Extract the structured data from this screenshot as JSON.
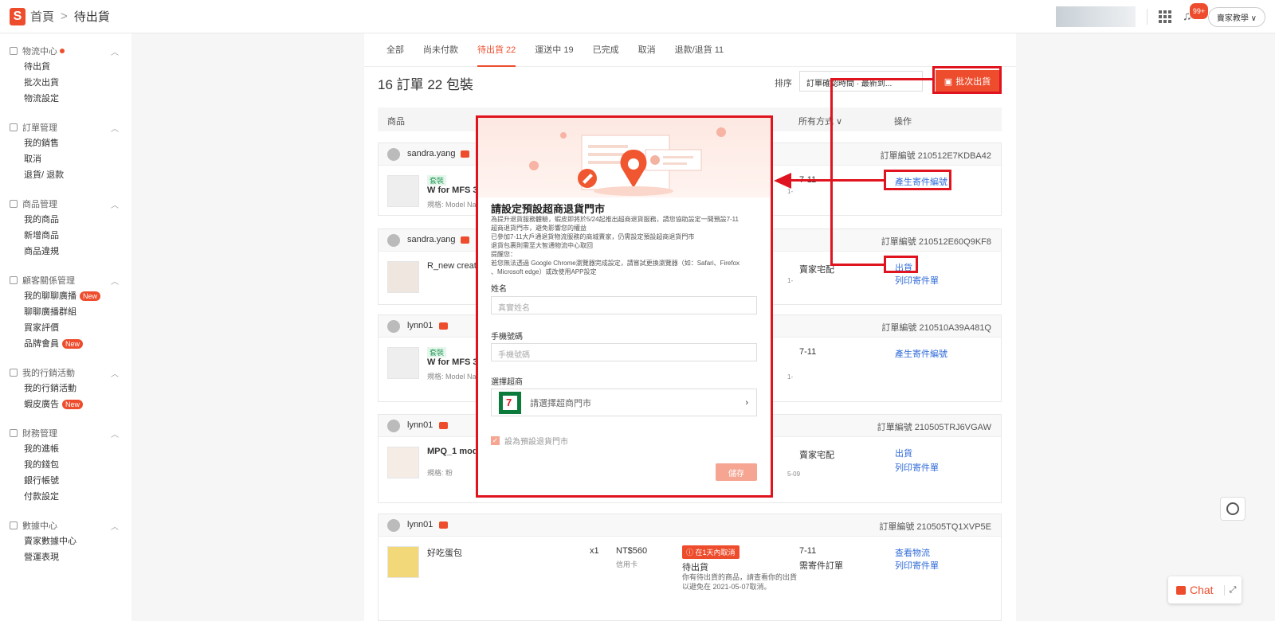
{
  "header": {
    "logo_letter": "S",
    "breadcrumb_home": "首頁",
    "breadcrumb_sep": ">",
    "breadcrumb_current": "待出貨",
    "notif_badge": "99+",
    "seller_button": "賣家教學 ∨"
  },
  "sidebar": {
    "groups": [
      {
        "title": "物流中心",
        "items": [
          "待出貨",
          "批次出貨",
          "物流設定"
        ]
      },
      {
        "title": "訂單管理",
        "items": [
          "我的銷售",
          "取消",
          "退貨/ 退款"
        ]
      },
      {
        "title": "商品管理",
        "items": [
          "我的商品",
          "新增商品",
          "商品違規"
        ]
      },
      {
        "title": "顧客關係管理",
        "items": [
          "我的聊聊廣播",
          "聊聊廣播群組",
          "買家評價",
          "品牌會員"
        ]
      },
      {
        "title": "我的行銷活動",
        "items": [
          "我的行銷活動",
          "蝦皮廣告"
        ]
      },
      {
        "title": "財務管理",
        "items": [
          "我的進帳",
          "我的錢包",
          "銀行帳號",
          "付款設定"
        ]
      },
      {
        "title": "數據中心",
        "items": [
          "賣家數據中心",
          "營運表現"
        ]
      }
    ],
    "new_badge": "New"
  },
  "tabs": [
    "全部",
    "尚未付款",
    "待出貨 22",
    "運送中 19",
    "已完成",
    "取消",
    "退款/退貨 11"
  ],
  "main": {
    "count_title": "16 訂單 22 包裝",
    "sort_label": "排序",
    "sort_value": "訂單確認時間 · 最新到...",
    "batch_button": "批次出貨",
    "table_headers": {
      "product": "商品",
      "shipping": "所有方式 ∨",
      "action": "操作"
    }
  },
  "orders": [
    {
      "user": "sandra.yang",
      "order_no": "訂單編號 210512E7KDBA42",
      "tag": "套裝",
      "product": "W for MFS 3(",
      "spec": "規格: Model Na",
      "shipping": "7-11",
      "fragment": "1-",
      "actions": [
        "產生寄件編號"
      ]
    },
    {
      "user": "sandra.yang",
      "order_no": "訂單編號 210512E60Q9KF8",
      "tag": "",
      "product": "R_new creat",
      "spec": "",
      "shipping": "賣家宅配",
      "fragment": "1-",
      "actions": [
        "出貨",
        "列印寄件單"
      ]
    },
    {
      "user": "lynn01",
      "order_no": "訂單編號 210510A39A481Q",
      "tag": "套裝",
      "product": "W for MFS 3(",
      "spec": "規格: Model Na",
      "shipping": "7-11",
      "fragment": "1-",
      "actions": [
        "產生寄件編號"
      ]
    },
    {
      "user": "lynn01",
      "order_no": "訂單編號 210505TRJ6VGAW",
      "tag": "",
      "product": "MPQ_1 mode",
      "spec": "規格: 粉",
      "shipping": "賣家宅配",
      "fragment": "5-09",
      "actions": [
        "出貨",
        "列印寄件單"
      ]
    },
    {
      "user": "lynn01",
      "order_no": "訂單編號 210505TQ1XVP5E",
      "tag": "",
      "product": "好吃蛋包",
      "spec": "",
      "qty": "x1",
      "price": "NT$560",
      "pay": "信用卡",
      "cancel_badge": "ⓘ 在1天內取消",
      "status": "待出貨",
      "status_desc": "你有待出貨的商品，請查看你的出貨以避免在 2021-05-07取消。",
      "shipping": "7-11",
      "shipping_sub": "需寄件訂單",
      "actions": [
        "查看物流",
        "列印寄件單"
      ]
    }
  ],
  "modal": {
    "title": "請設定預設超商退貨門市",
    "desc_lines": [
      "為提升退貨服務體驗，蝦皮即將於5/24起推出超商退貨服務，請您協助設定一間預設7-11",
      "超商退貨門市，避免影響您的權益",
      "已參加7-11大戶通退貨物流服務的商城賣家，仍需設定預設超商退貨門市",
      "退貨包裹則需至大智通物流中心取回",
      "提醒您：",
      "若您無法透過 Google Chrome瀏覽器完成設定，請嘗試更換瀏覽器（如：Safari、Firefox",
      "、Microsoft edge）或改使用APP設定"
    ],
    "name_label": "姓名",
    "name_placeholder": "真實姓名",
    "phone_label": "手機號碼",
    "phone_placeholder": "手機號碼",
    "store_label": "選擇超商",
    "store_logo": "7",
    "store_placeholder": "請選擇超商門市",
    "store_chevron": "›",
    "default_checkbox": "設為預設退貨門市",
    "save_button": "儲存"
  },
  "widgets": {
    "chat_label": "Chat",
    "chat_expand": "⤢"
  },
  "colors": {
    "accent": "#ee4d2d",
    "highlight": "#e0141e",
    "link": "#2f6ad9"
  }
}
